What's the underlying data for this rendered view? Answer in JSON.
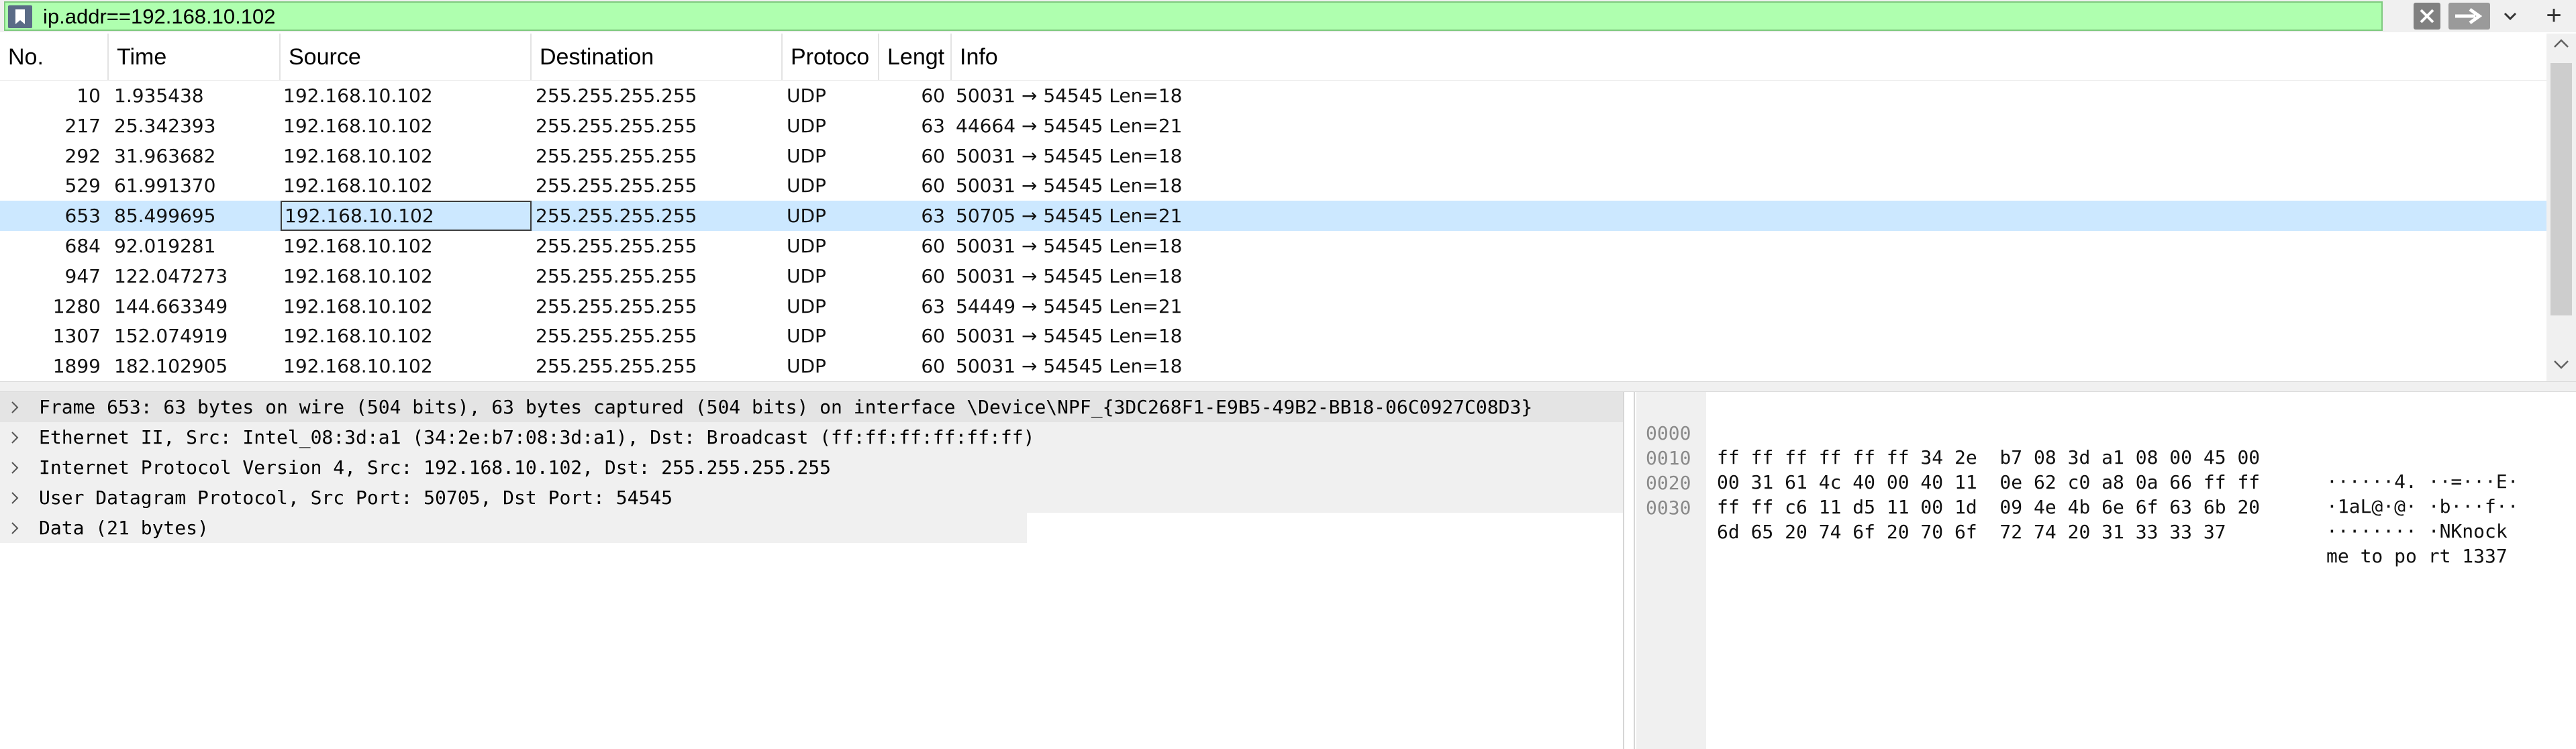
{
  "filter": {
    "value": "ip.addr==192.168.10.102",
    "icons": {
      "bookmark": "bookmark-icon",
      "clear": "clear-x-icon",
      "apply": "apply-arrow-icon",
      "dropdown": "chevron-down-icon",
      "add": "plus-icon"
    },
    "add_label": "+"
  },
  "packet_list": {
    "columns": [
      "No.",
      "Time",
      "Source",
      "Destination",
      "Protoco",
      "Lengt",
      "Info"
    ],
    "rows": [
      {
        "no": "10",
        "time": "1.935438",
        "source": "192.168.10.102",
        "destination": "255.255.255.255",
        "protocol": "UDP",
        "length": "60",
        "info": "50031 → 54545 Len=18"
      },
      {
        "no": "217",
        "time": "25.342393",
        "source": "192.168.10.102",
        "destination": "255.255.255.255",
        "protocol": "UDP",
        "length": "63",
        "info": "44664 → 54545 Len=21"
      },
      {
        "no": "292",
        "time": "31.963682",
        "source": "192.168.10.102",
        "destination": "255.255.255.255",
        "protocol": "UDP",
        "length": "60",
        "info": "50031 → 54545 Len=18"
      },
      {
        "no": "529",
        "time": "61.991370",
        "source": "192.168.10.102",
        "destination": "255.255.255.255",
        "protocol": "UDP",
        "length": "60",
        "info": "50031 → 54545 Len=18"
      },
      {
        "no": "653",
        "time": "85.499695",
        "source": "192.168.10.102",
        "destination": "255.255.255.255",
        "protocol": "UDP",
        "length": "63",
        "info": "50705 → 54545 Len=21",
        "selected": true
      },
      {
        "no": "684",
        "time": "92.019281",
        "source": "192.168.10.102",
        "destination": "255.255.255.255",
        "protocol": "UDP",
        "length": "60",
        "info": "50031 → 54545 Len=18"
      },
      {
        "no": "947",
        "time": "122.047273",
        "source": "192.168.10.102",
        "destination": "255.255.255.255",
        "protocol": "UDP",
        "length": "60",
        "info": "50031 → 54545 Len=18"
      },
      {
        "no": "1280",
        "time": "144.663349",
        "source": "192.168.10.102",
        "destination": "255.255.255.255",
        "protocol": "UDP",
        "length": "63",
        "info": "54449 → 54545 Len=21"
      },
      {
        "no": "1307",
        "time": "152.074919",
        "source": "192.168.10.102",
        "destination": "255.255.255.255",
        "protocol": "UDP",
        "length": "60",
        "info": "50031 → 54545 Len=18"
      },
      {
        "no": "1899",
        "time": "182.102905",
        "source": "192.168.10.102",
        "destination": "255.255.255.255",
        "protocol": "UDP",
        "length": "60",
        "info": "50031 → 54545 Len=18"
      }
    ]
  },
  "details": {
    "items": [
      "Frame 653: 63 bytes on wire (504 bits), 63 bytes captured (504 bits) on interface \\Device\\NPF_{3DC268F1-E9B5-49B2-BB18-06C0927C08D3}",
      "Ethernet II, Src: Intel_08:3d:a1 (34:2e:b7:08:3d:a1), Dst: Broadcast (ff:ff:ff:ff:ff:ff)",
      "Internet Protocol Version 4, Src: 192.168.10.102, Dst: 255.255.255.255",
      "User Datagram Protocol, Src Port: 50705, Dst Port: 54545",
      "Data (21 bytes)"
    ]
  },
  "bytes": {
    "lines": [
      {
        "offset": "0000",
        "hex": "ff ff ff ff ff ff 34 2e  b7 08 3d a1 08 00 45 00",
        "ascii": "······4. ··=···E·"
      },
      {
        "offset": "0010",
        "hex": "00 31 61 4c 40 00 40 11  0e 62 c0 a8 0a 66 ff ff",
        "ascii": "·1aL@·@· ·b···f··"
      },
      {
        "offset": "0020",
        "hex": "ff ff c6 11 d5 11 00 1d  09 4e 4b 6e 6f 63 6b 20",
        "ascii": "········ ·NKnock "
      },
      {
        "offset": "0030",
        "hex": "6d 65 20 74 6f 20 70 6f  72 74 20 31 33 33 37",
        "ascii": "me to po rt 1337"
      }
    ]
  },
  "colors": {
    "filter_valid_bg": "#afffaf",
    "selected_row_bg": "#cce8ff",
    "pane_bg": "#f0f0f0"
  }
}
